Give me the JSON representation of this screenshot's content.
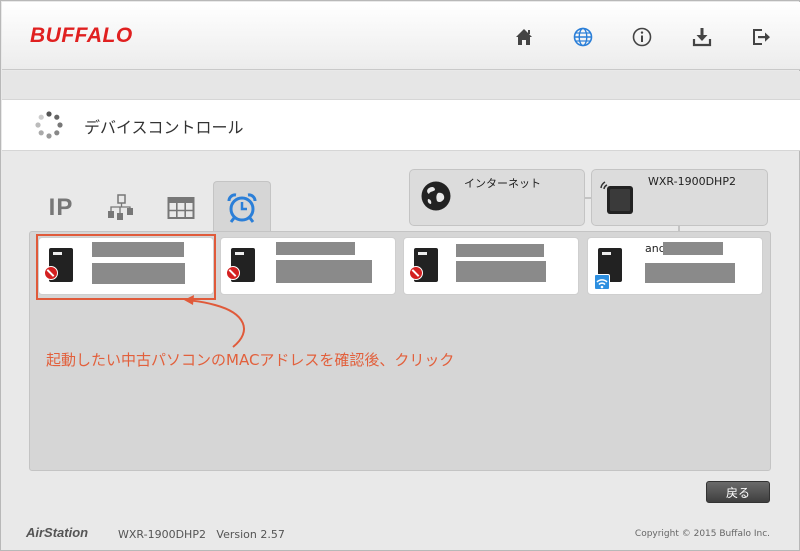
{
  "header": {
    "brand": "BUFFALO",
    "nav": [
      {
        "name": "home-icon",
        "color": "#444444"
      },
      {
        "name": "globe-icon",
        "color": "#2b7fd8"
      },
      {
        "name": "info-icon",
        "color": "#444444"
      },
      {
        "name": "download-icon",
        "color": "#444444"
      },
      {
        "name": "logout-icon",
        "color": "#444444"
      }
    ]
  },
  "page": {
    "title": "デバイスコントロール",
    "title_icon": "spinner-icon"
  },
  "network": {
    "internet_label": "インターネット",
    "router_label": "WXR-1900DHP2"
  },
  "tabs": [
    {
      "label": "IP",
      "icon": "ip-icon",
      "active": false
    },
    {
      "label": "",
      "icon": "network-map-icon",
      "active": false
    },
    {
      "label": "",
      "icon": "grid-icon",
      "active": false
    },
    {
      "label": "",
      "icon": "alarm-clock-icon",
      "active": true
    }
  ],
  "devices": [
    {
      "status": "blocked",
      "name_prefix": ""
    },
    {
      "status": "blocked",
      "name_prefix": ""
    },
    {
      "status": "blocked",
      "name_prefix": ""
    },
    {
      "status": "wifi",
      "name_prefix": "and"
    }
  ],
  "annotation": {
    "text": "起動したい中古パソコンのMACアドレスを確認後、クリック",
    "color": "#e2603c"
  },
  "buttons": {
    "back": "戻る"
  },
  "footer": {
    "brand": "AirStation",
    "model_version": "WXR-1900DHP2   Version 2.57",
    "copyright": "Copyright © 2015 Buffalo Inc."
  },
  "colors": {
    "brand": "#e02020",
    "accent": "#2b7fd8",
    "blocked": "#d42020"
  }
}
